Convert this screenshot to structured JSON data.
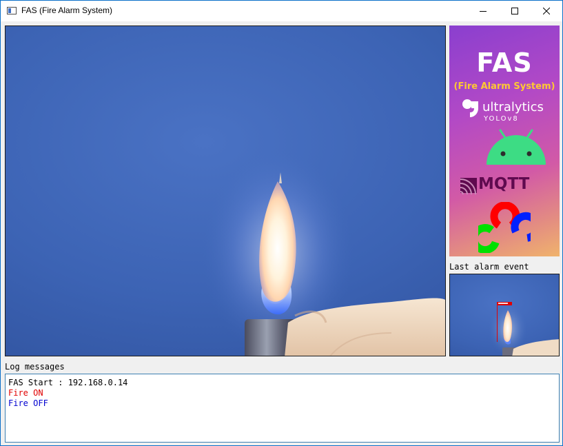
{
  "window": {
    "title": "FAS (Fire Alarm System)",
    "controls": {
      "minimize": "minimize-icon",
      "maximize": "maximize-icon",
      "close": "close-icon"
    }
  },
  "banner": {
    "title": "FAS",
    "subtitle": "(Fire Alarm System)",
    "logos": {
      "ultralytics_word": "ultralytics",
      "ultralytics_version": "YOLOv8",
      "android": "android-icon",
      "mqtt_word": "MQTT",
      "opencv": "opencv-icon"
    },
    "colors": {
      "subtitle": "#ffc832",
      "android": "#3ddc84",
      "mqtt": "#5f0a4f"
    }
  },
  "last_alarm": {
    "label": "Last alarm event"
  },
  "log": {
    "label": "Log messages",
    "messages": [
      {
        "text": "FAS Start : 192.168.0.14",
        "color": "#000000"
      },
      {
        "text": "Fire ON",
        "color": "#e00000"
      },
      {
        "text": "Fire OFF",
        "color": "#0000d0"
      }
    ]
  },
  "colors": {
    "titlebar": "#ffffff",
    "window_bg": "#f0f0f0",
    "log_border": "#3c7fb1"
  }
}
